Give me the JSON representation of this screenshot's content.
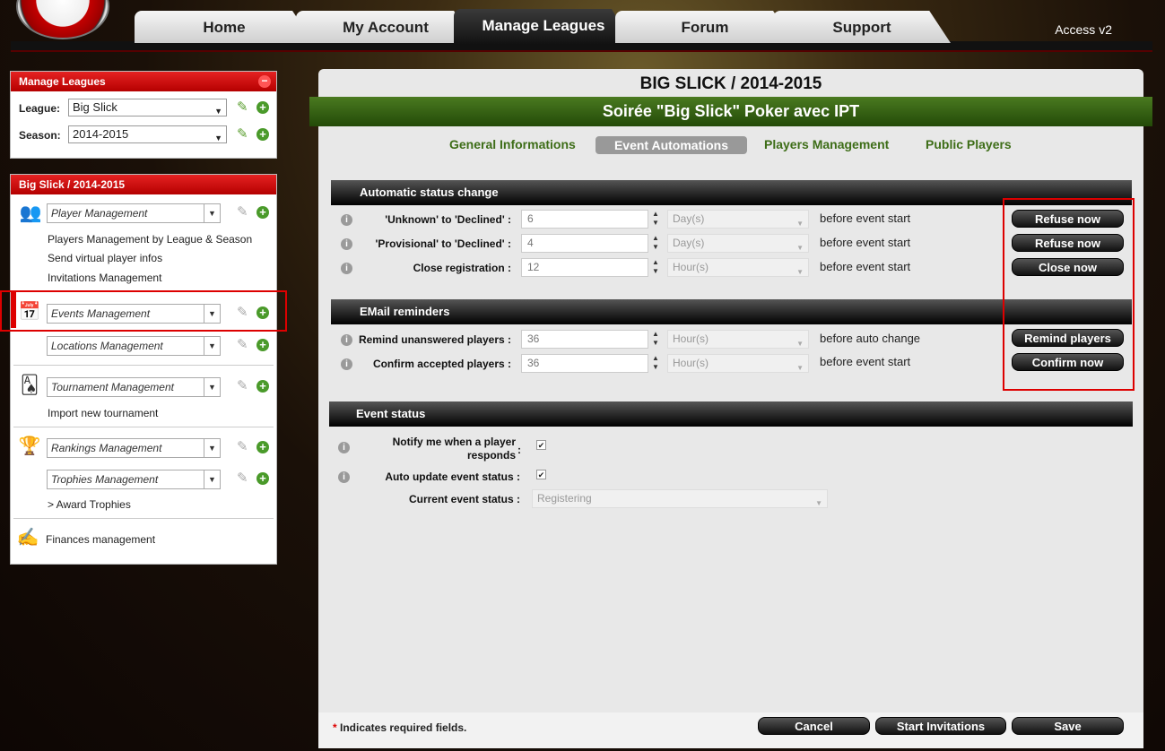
{
  "nav": {
    "tabs": [
      "Home",
      "My Account",
      "Manage Leagues",
      "Forum",
      "Support"
    ],
    "active_tab": "Manage Leagues",
    "version": "Access v2"
  },
  "sidebar": {
    "manage_leagues": {
      "title": "Manage Leagues",
      "league_label": "League:",
      "league_value": "Big Slick",
      "season_label": "Season:",
      "season_value": "2014-2015"
    },
    "season_panel": {
      "title": "Big Slick / 2014-2015",
      "player_select": "Player Management",
      "player_links": [
        "Players Management by League & Season",
        "Send virtual player infos",
        "Invitations Management"
      ],
      "events_select": "Events Management",
      "locations_select": "Locations Management",
      "tournament_select": "Tournament Management",
      "tournament_link": "Import new tournament",
      "rankings_select": "Rankings Management",
      "trophies_select": "Trophies Management",
      "trophies_link": "> Award Trophies",
      "finances_link": "Finances management"
    }
  },
  "main": {
    "league_title": "BIG SLICK / 2014-2015",
    "event_title": "Soirée \"Big Slick\" Poker avec IPT",
    "subtabs": [
      "General Informations",
      "Event Automations",
      "Players Management",
      "Public Players"
    ],
    "active_subtab": "Event Automations",
    "automatic": {
      "title": "Automatic status change",
      "rows": [
        {
          "label": "'Unknown' to 'Declined' :",
          "value": "6",
          "unit": "Day(s)",
          "after": "before event start",
          "button": "Refuse now"
        },
        {
          "label": "'Provisional' to 'Declined' :",
          "value": "4",
          "unit": "Day(s)",
          "after": "before event start",
          "button": "Refuse now"
        },
        {
          "label": "Close registration :",
          "value": "12",
          "unit": "Hour(s)",
          "after": "before event start",
          "button": "Close now"
        }
      ]
    },
    "email": {
      "title": "EMail reminders",
      "rows": [
        {
          "label": "Remind unanswered players :",
          "value": "36",
          "unit": "Hour(s)",
          "after": "before auto change",
          "button": "Remind players"
        },
        {
          "label": "Confirm accepted players :",
          "value": "36",
          "unit": "Hour(s)",
          "after": "before event start",
          "button": "Confirm now"
        }
      ]
    },
    "event_status": {
      "title": "Event status",
      "notify_label_1": "Notify me when a player",
      "notify_label_2": "responds",
      "notify_colon": ":",
      "notify_checked": true,
      "auto_update_label": "Auto update event status :",
      "auto_update_checked": true,
      "current_label": "Current event status :",
      "current_value": "Registering"
    },
    "footer": {
      "required_star": "*",
      "required_text": " Indicates required fields.",
      "cancel": "Cancel",
      "start": "Start Invitations",
      "save": "Save"
    }
  },
  "colors": {
    "header_red": "#d30000",
    "green_bar": "#3a6414",
    "tab_link_green": "#3d6d17",
    "highlight_box": "#dd0000"
  }
}
